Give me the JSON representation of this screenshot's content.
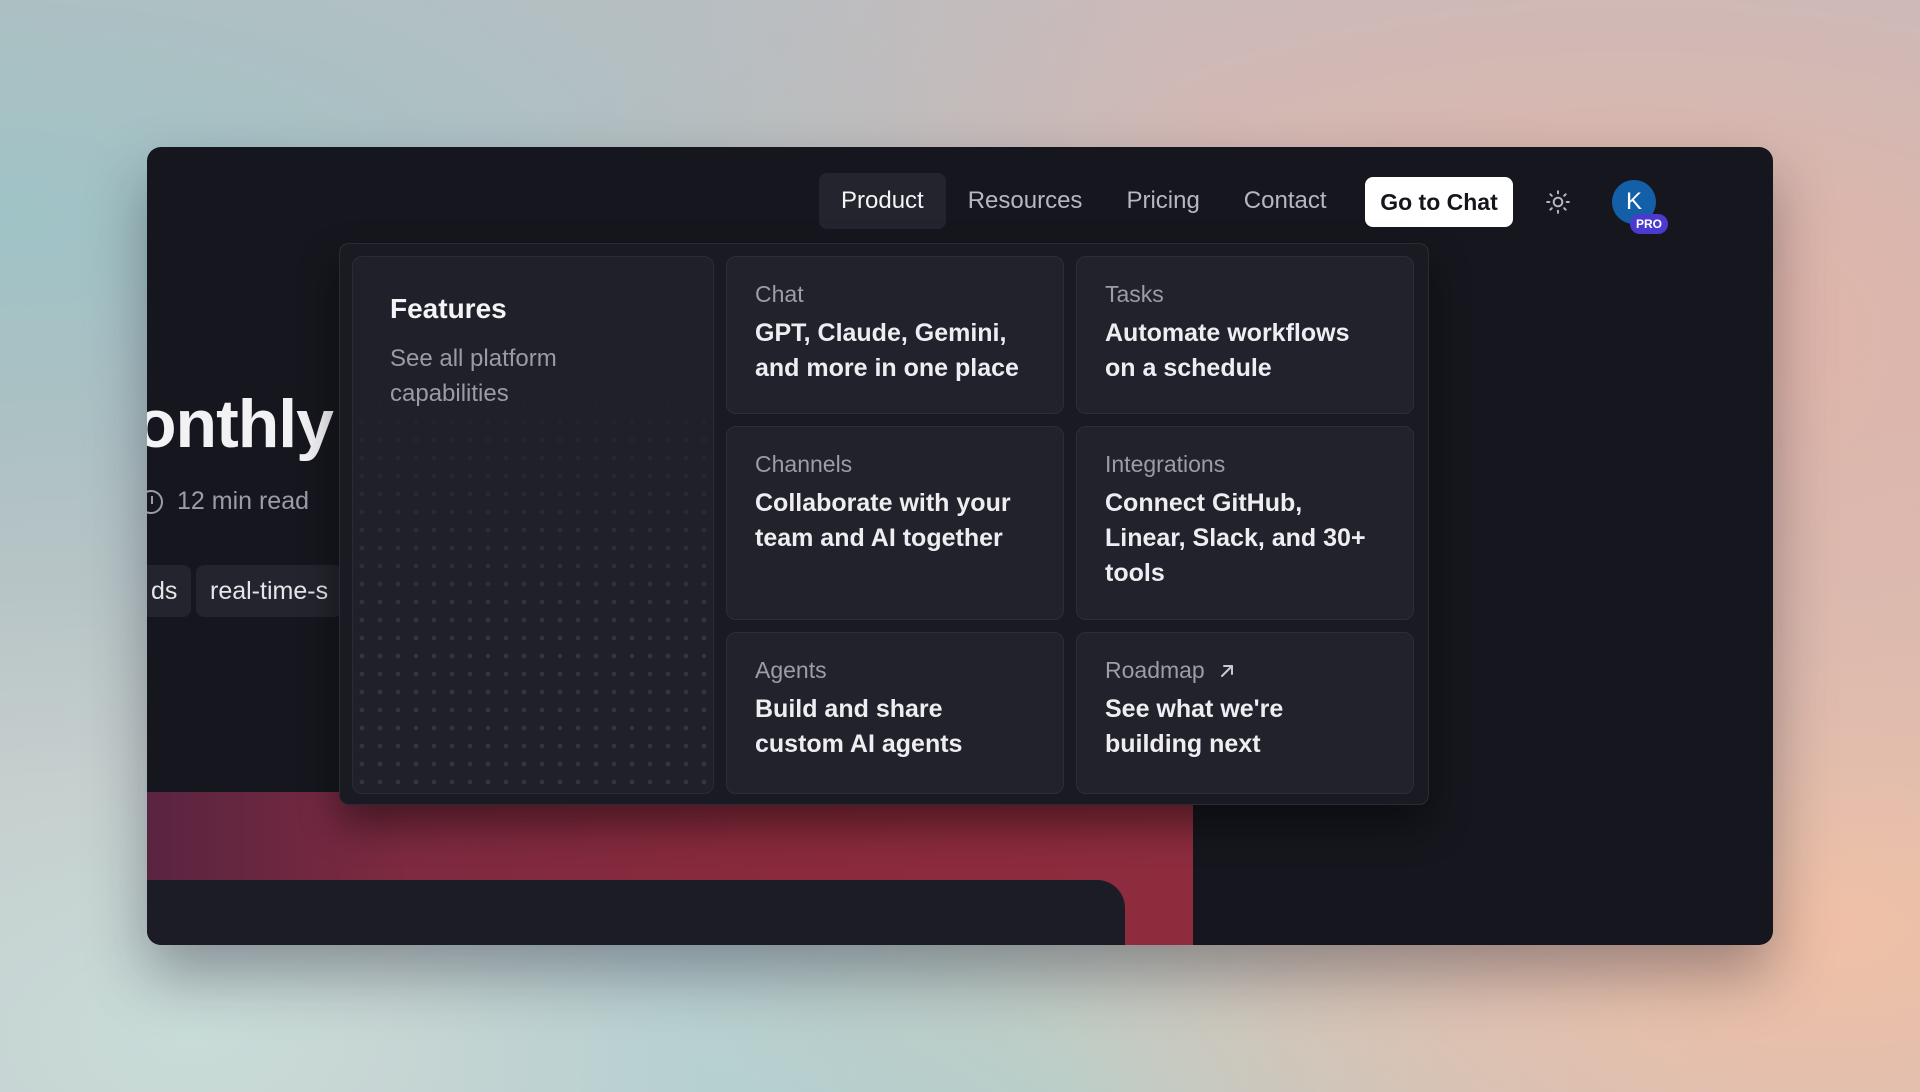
{
  "article": {
    "title_fragment": "onthly U",
    "read_time": "12 min read",
    "tags": [
      "ds",
      "real-time-s"
    ]
  },
  "nav": {
    "items": [
      "Product",
      "Resources",
      "Pricing",
      "Contact"
    ],
    "active": "Product",
    "cta_label": "Go to Chat",
    "theme_icon": "sun-icon",
    "avatar_initial": "K",
    "badge": "PRO"
  },
  "dropdown": {
    "feature": {
      "title": "Features",
      "description": "See all platform capabilities"
    },
    "cards": [
      {
        "title": "Chat",
        "description": "GPT, Claude, Gemini, and more in one place"
      },
      {
        "title": "Tasks",
        "description": "Automate workflows on a schedule"
      },
      {
        "title": "Channels",
        "description": "Collaborate with your team and AI together"
      },
      {
        "title": "Integrations",
        "description": "Connect GitHub, Linear, Slack, and 30+ tools"
      },
      {
        "title": "Agents",
        "description": "Build and share custom AI agents"
      },
      {
        "title": "Roadmap",
        "description": "See what we're building next",
        "icon": "arrow-up-right-icon"
      }
    ]
  },
  "colors": {
    "window_bg": "#16171e",
    "avatar_bg": "#1460a8",
    "badge_bg": "#4b3ad0",
    "hero_accent": "#8a2a3c"
  }
}
